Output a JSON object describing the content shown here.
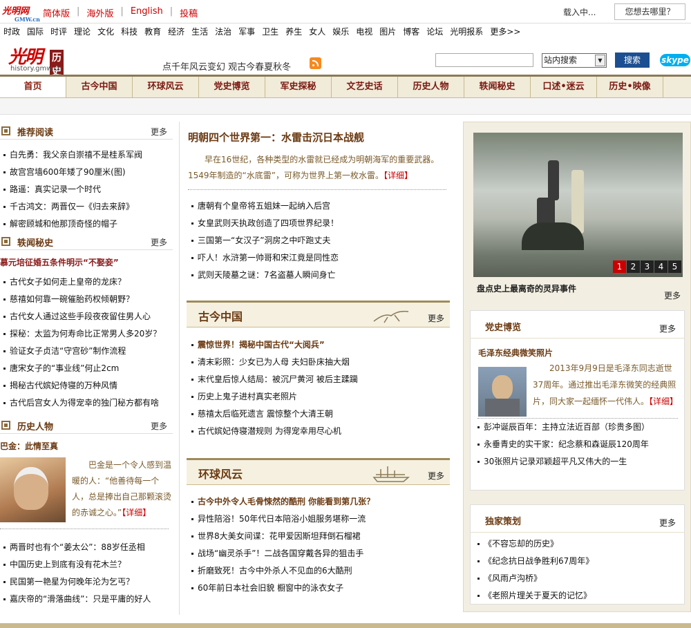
{
  "topbar": {
    "logo_text": "光明网",
    "logo_sub": "GMW.cn",
    "links": [
      "简体版",
      "海外版",
      "English",
      "投稿"
    ],
    "loading": "载入中...",
    "where": "您想去哪里？"
  },
  "channels": [
    "时政",
    "国际",
    "时评",
    "理论",
    "文化",
    "科技",
    "教育",
    "经济",
    "生活",
    "法治",
    "军事",
    "卫生",
    "养生",
    "女人",
    "娱乐",
    "电视",
    "图片",
    "博客",
    "论坛",
    "光明报系",
    "更多>>"
  ],
  "header": {
    "logo": "光明",
    "logo_tag": "历史",
    "domain": "history.gmw.cn",
    "slogan": "点千年风云变幻  观古今春夏秋冬",
    "search_placeholder": "",
    "search_scope": "站内搜索",
    "search_btn": "搜索",
    "skype": "skype"
  },
  "mainnav": [
    "首页",
    "古今中国",
    "环球风云",
    "党史博览",
    "军史探秘",
    "文艺史话",
    "历史人物",
    "轶闻秘史",
    "口述•迷云",
    "历史•映像"
  ],
  "left": {
    "rec": {
      "title": "推荐阅读",
      "more": "更多",
      "items": [
        "白先勇：我父亲白崇禧不是桂系军阀",
        "故宫宫墙600年矮了90厘米(图)",
        "路遥：真实记录一个时代",
        "千古鸿文：两晋仅一《归去来辞》",
        "解密顾城和他那顶奇怪的帽子"
      ]
    },
    "yiwen": {
      "title": "轶闻秘史",
      "more": "更多",
      "headline": "慕元培征婚五条件明示“不娶妾”",
      "items": [
        "古代女子如何走上皇帝的龙床？",
        "慈禧如何靠一碗催胎药权倾朝野？",
        "古代女人通过这些手段夜夜留住男人心",
        "探秘：太监为何寿命比正常男人多20岁？",
        "验证女子贞洁“守宫砂”制作流程",
        "唐宋女子的“事业线”何止2cm",
        "揭秘古代嫔妃侍寝的万种风情",
        "古代后宫女人为得宠幸的独门秘方都有啥"
      ]
    },
    "people": {
      "title": "历史人物",
      "more": "更多",
      "headline": "巴金：此情至真",
      "text": "巴金是一个令人感到温暖的人：“他善待每一个人，总是捧出自己那颗滚烫的赤诚之心。”",
      "detail": "【详细】",
      "items": [
        "两晋时也有个“姜太公”：88岁任丞相",
        "中国历史上到底有没有花木兰？",
        "民国第一艳星为何晚年沦为乞丐？",
        "嘉庆帝的“滑落曲线”：只是平庸的好人"
      ]
    }
  },
  "mid": {
    "headline": "明朝四个世界第一：水雷击沉日本战舰",
    "headline_text": "早在16世纪，各种类型的水雷就已经成为明朝海军的重要武器。1549年制造的“水底雷”，可称为世界上第一枚水雷。",
    "detail": "【详细】",
    "top_items": [
      "唐朝有个皇帝将五姐妹一起纳入后宫",
      "女皇武则天执政创造了四项世界纪录！",
      "三国第一“女汉子”洞房之中吓跑丈夫",
      "吓人！水浒第一帅哥和宋江竟是同性恋",
      "武则天陵墓之谜：7名盗墓人瞬间身亡"
    ],
    "china": {
      "title": "古今中国",
      "more": "更多",
      "headline": "震惊世界！揭秘中国古代“大阅兵”",
      "items": [
        "清末彩照：少女已为人母 夫妇卧床抽大烟",
        "末代皇后惊人结局：被沉尸黄河 被后主蹂躏",
        "历史上鬼子进村真实老照片",
        "慈禧太后临死遗言 震惊整个大清王朝",
        "古代嫔妃侍寝潜规则 为得宠幸用尽心机"
      ]
    },
    "world": {
      "title": "环球风云",
      "more": "更多",
      "headline": "古今中外令人毛骨悚然的酷刑 你能看到第几张？",
      "items": [
        "异性陪浴！50年代日本陪浴小姐服务堪称一流",
        "世界8大美女间谍：花甲爱因斯坦拜倒石榴裙",
        "战场“幽灵杀手”！二战各国穿戴各异的狙击手",
        "折磨致死！古今中外杀人不见血的6大酷刑",
        "60年前日本社会旧貌 橱窗中的泳衣女子"
      ]
    }
  },
  "right": {
    "slider": {
      "pages": [
        "1",
        "2",
        "3",
        "4",
        "5"
      ],
      "active_page": "1",
      "caption": "盘点史上最离奇的灵异事件",
      "more": "更多"
    },
    "party": {
      "title": "党史博览",
      "more": "更多",
      "headline": "毛泽东经典微笑照片",
      "text": "2013年9月9日是毛泽东同志逝世37周年。通过推出毛泽东微笑的经典照片，同大家一起缅怀一代伟人。",
      "detail": "【详细】",
      "items": [
        "彭冲诞辰百年：主持立法近百部（珍贵多图）",
        "永垂青史的实干家：纪念蔡和森诞辰120周年",
        "30张照片记录邓颖超平凡又伟大的一生"
      ]
    },
    "special": {
      "title": "独家策划",
      "more": "更多",
      "items": [
        "《不容忘却的历史》",
        "《纪念抗日战争胜利67周年》",
        "《风雨卢沟桥》",
        "《老照片理关于夏天的记忆》"
      ]
    }
  },
  "colors": {
    "brand_red": "#cc0000",
    "brown": "#6b3a12",
    "nav_bg": "#f1ebd9",
    "search_blue": "#1c4f91",
    "skype": "#00aff0"
  }
}
